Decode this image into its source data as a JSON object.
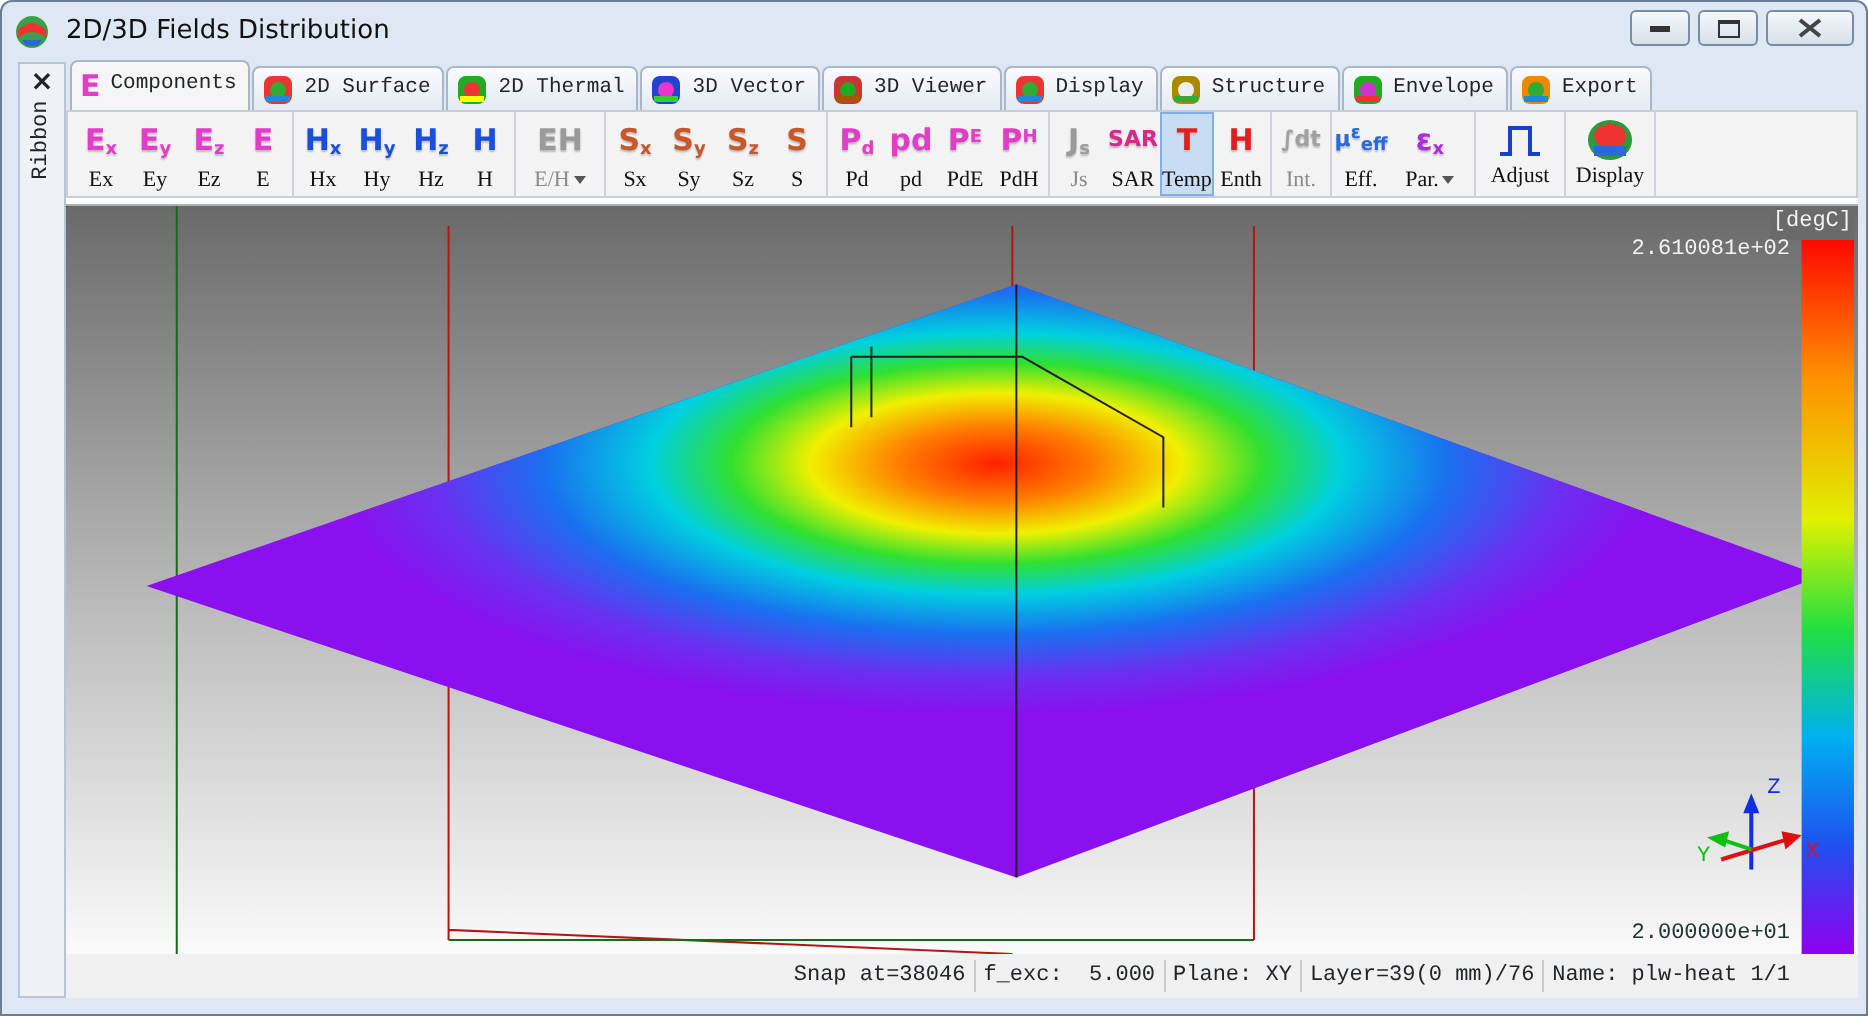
{
  "window": {
    "title": "2D/3D Fields Distribution"
  },
  "ribbon_side": {
    "label": "Ribbon",
    "close": "×"
  },
  "tabs": [
    {
      "label": "Components",
      "glyph": "E",
      "selected": true
    },
    {
      "label": "2D Surface",
      "selected": false
    },
    {
      "label": "2D Thermal",
      "selected": false
    },
    {
      "label": "3D Vector",
      "selected": false
    },
    {
      "label": "3D Viewer",
      "selected": false
    },
    {
      "label": "Display",
      "selected": false
    },
    {
      "label": "Structure",
      "selected": false
    },
    {
      "label": "Envelope",
      "selected": false
    },
    {
      "label": "Export",
      "selected": false
    }
  ],
  "ribbon_groups": [
    [
      {
        "kind": "glyph",
        "glyph": "E$_{x}$",
        "color": "#e23cc8",
        "label": "Ex",
        "disabled": false,
        "selected": false
      },
      {
        "kind": "glyph",
        "glyph": "E$_{y}$",
        "color": "#e23cc8",
        "label": "Ey",
        "disabled": false,
        "selected": false
      },
      {
        "kind": "glyph",
        "glyph": "E$_{z}$",
        "color": "#e23cc8",
        "label": "Ez",
        "disabled": false,
        "selected": false
      },
      {
        "kind": "glyph",
        "glyph": "E",
        "color": "#e23cc8",
        "label": "E",
        "disabled": false,
        "selected": false
      }
    ],
    [
      {
        "kind": "glyph",
        "glyph": "H$_{x}$",
        "color": "#1a4fd8",
        "label": "Hx",
        "disabled": false,
        "selected": false
      },
      {
        "kind": "glyph",
        "glyph": "H$_{y}$",
        "color": "#1a4fd8",
        "label": "Hy",
        "disabled": false,
        "selected": false
      },
      {
        "kind": "glyph",
        "glyph": "H$_{z}$",
        "color": "#1a4fd8",
        "label": "Hz",
        "disabled": false,
        "selected": false
      },
      {
        "kind": "glyph",
        "glyph": "H",
        "color": "#1a4fd8",
        "label": "H",
        "disabled": false,
        "selected": false
      }
    ],
    [
      {
        "kind": "glyph",
        "glyph": "EH",
        "color": "#9a9a9a",
        "label": "E/H",
        "disabled": true,
        "selected": false,
        "dropdown": true
      }
    ],
    [
      {
        "kind": "glyph",
        "glyph": "S$_{x}$",
        "color": "#c8582a",
        "label": "Sx",
        "disabled": false,
        "selected": false
      },
      {
        "kind": "glyph",
        "glyph": "S$_{y}$",
        "color": "#c8582a",
        "label": "Sy",
        "disabled": false,
        "selected": false
      },
      {
        "kind": "glyph",
        "glyph": "S$_{z}$",
        "color": "#c8582a",
        "label": "Sz",
        "disabled": false,
        "selected": false
      },
      {
        "kind": "glyph",
        "glyph": "S",
        "color": "#c8582a",
        "label": "S",
        "disabled": false,
        "selected": false
      }
    ],
    [
      {
        "kind": "glyph",
        "glyph": "P$_{d}$",
        "color": "#e23cc8",
        "label": "Pd",
        "disabled": false,
        "selected": false
      },
      {
        "kind": "glyph",
        "glyph": "pd",
        "color": "#e23cc8",
        "label": "pd",
        "disabled": false,
        "selected": false
      },
      {
        "kind": "glyph",
        "glyph": "P$^{E}$",
        "color": "#e23cc8",
        "label": "PdE",
        "disabled": false,
        "selected": false
      },
      {
        "kind": "glyph",
        "glyph": "P$^{H}$",
        "color": "#e23cc8",
        "label": "PdH",
        "disabled": false,
        "selected": false
      }
    ],
    [
      {
        "kind": "glyph",
        "glyph": "J$_{s}$",
        "color": "#9a9a9a",
        "label": "Js",
        "disabled": true,
        "selected": false
      },
      {
        "kind": "glyph",
        "glyph": "SAR",
        "color": "#d8288c",
        "label": "SAR",
        "disabled": false,
        "selected": false
      },
      {
        "kind": "glyph",
        "glyph": "T",
        "color": "#e02020",
        "label": "Temp",
        "disabled": false,
        "selected": true
      },
      {
        "kind": "glyph",
        "glyph": "H",
        "color": "#e02020",
        "label": "Enth",
        "disabled": false,
        "selected": false
      }
    ],
    [
      {
        "kind": "glyph",
        "glyph": "∫dt",
        "color": "#a0a0a0",
        "label": "Int.",
        "disabled": true,
        "selected": false
      }
    ],
    [
      {
        "kind": "glyph",
        "glyph": "μ$^{ε}$$_{eff}$",
        "color": "#2a6ad8",
        "label": "Eff.",
        "disabled": false,
        "selected": false
      },
      {
        "kind": "glyph",
        "glyph": "ε$_{x}$",
        "color": "#b02ae0",
        "label": "Par.",
        "disabled": false,
        "selected": false,
        "dropdown": true
      }
    ],
    [
      {
        "kind": "pulse",
        "label": "Adjust",
        "disabled": false,
        "selected": false
      }
    ],
    [
      {
        "kind": "mesh",
        "label": "Display",
        "disabled": false,
        "selected": false
      }
    ]
  ],
  "plot": {
    "unit": "[degC]",
    "max_label": "2.610081e+02",
    "min_label": "2.000000e+01",
    "axes": {
      "z": "Z",
      "x": "X",
      "y": "Y"
    }
  },
  "status_bar": [
    "Snap at=38046",
    "f_exc:  5.000",
    "Plane: XY",
    "Layer=39(0 mm)/76",
    "Name: plw-heat 1/1"
  ]
}
